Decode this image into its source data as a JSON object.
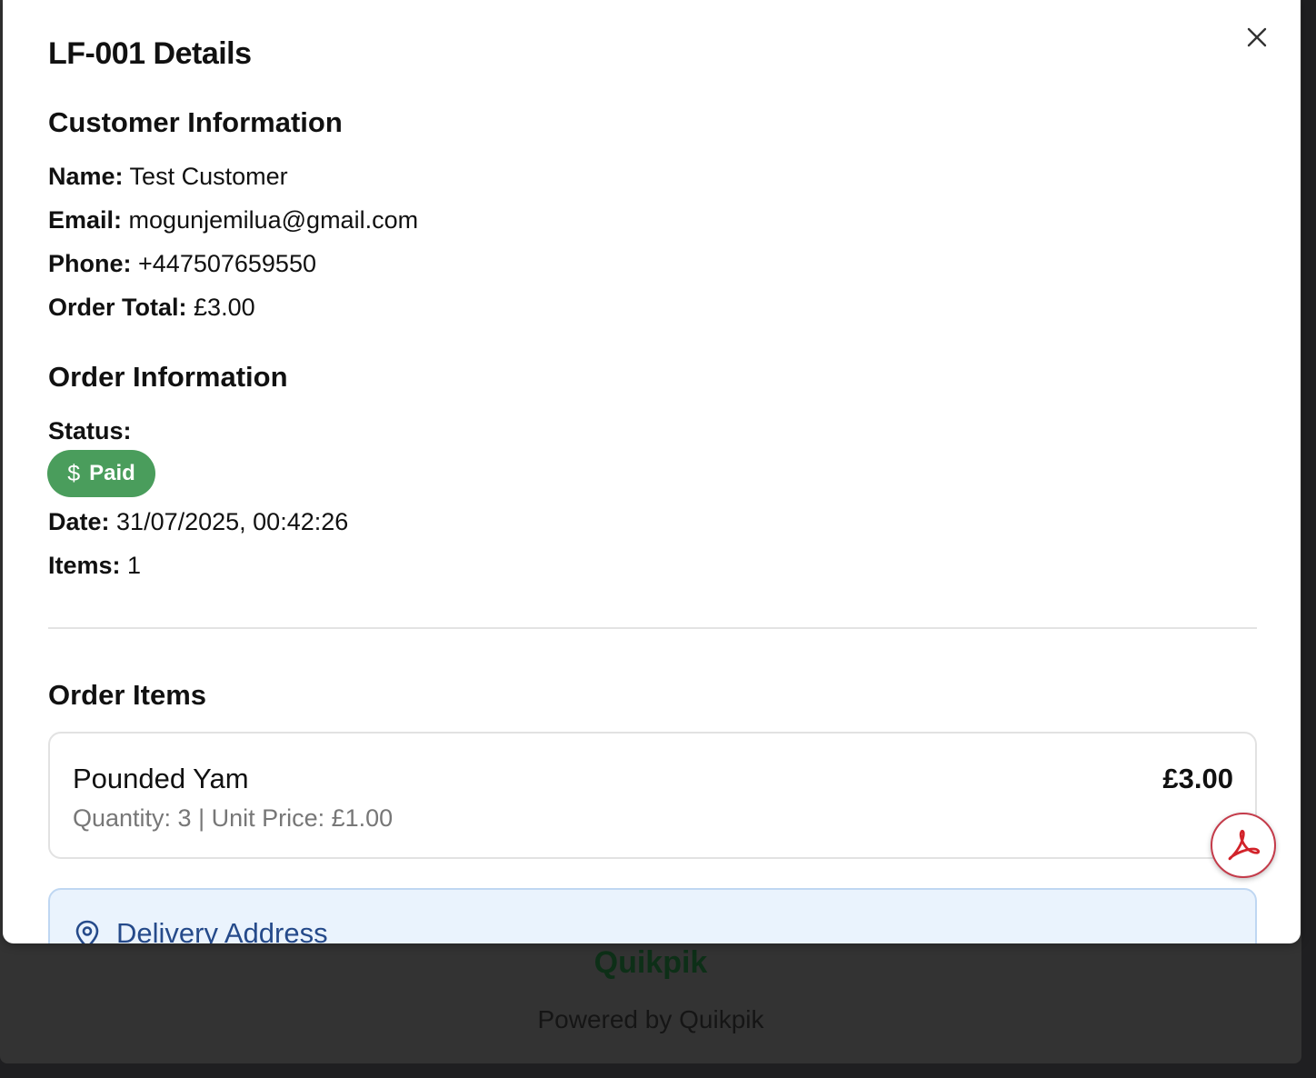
{
  "footer": {
    "brand": "Quikpik",
    "powered_by": "Powered by Quikpik"
  },
  "modal": {
    "title": "LF-001 Details",
    "close_icon": "close-icon"
  },
  "customer": {
    "heading": "Customer Information",
    "name_label": "Name:",
    "name_value": "Test Customer",
    "email_label": "Email:",
    "email_value": "mogunjemilua@gmail.com",
    "phone_label": "Phone:",
    "phone_value": "+447507659550",
    "total_label": "Order Total:",
    "total_value": "£3.00"
  },
  "order": {
    "heading": "Order Information",
    "status_label": "Status:",
    "status_icon": "$",
    "status_value": "Paid",
    "status_color": "#4a9d5c",
    "date_label": "Date:",
    "date_value": "31/07/2025, 00:42:26",
    "items_label": "Items:",
    "items_value": "1"
  },
  "order_items": {
    "heading": "Order Items",
    "items": [
      {
        "name": "Pounded Yam",
        "meta": "Quantity: 3 | Unit Price: £1.00",
        "price": "£3.00"
      }
    ]
  },
  "delivery": {
    "heading": "Delivery Address",
    "icon": "map-pin-icon"
  },
  "pdf_button": {
    "icon": "pdf-icon"
  }
}
